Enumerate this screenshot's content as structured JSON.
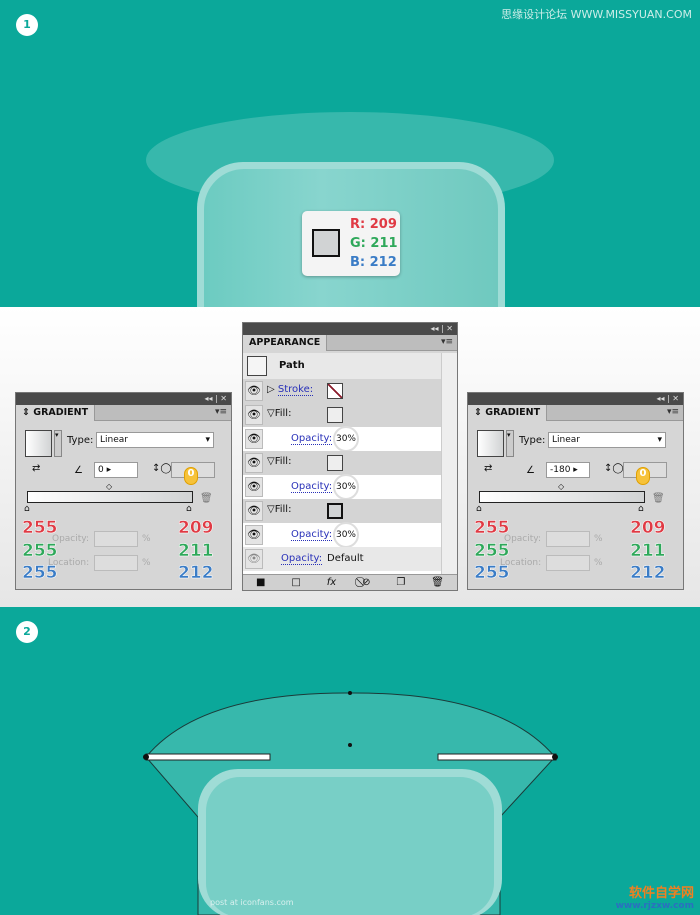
{
  "watermark_top": "思缘设计论坛 WWW.MISSYUAN.COM",
  "step1": {
    "badge": "1",
    "color": {
      "r": "R: 209",
      "g": "G: 211",
      "b": "B: 212",
      "swatch": "#d1d3d4"
    }
  },
  "step2": {
    "badge": "2"
  },
  "appearance": {
    "title": "APPEARANCE",
    "object": "Path",
    "stroke_label": "Stroke:",
    "fill_label": "Fill:",
    "opacity_label": "Opacity:",
    "fills": [
      {
        "opacity": "30%"
      },
      {
        "opacity": "30%"
      },
      {
        "opacity": "30%"
      }
    ],
    "opacity_value": "Default",
    "fx": "fx"
  },
  "gradient_left": {
    "title": "GRADIENT",
    "type_label": "Type:",
    "type": "Linear",
    "angle": "0",
    "aspect_value": "0",
    "opacity_label": "Opacity:",
    "location_label": "Location:",
    "percent": "%",
    "start": {
      "r": "255",
      "g": "255",
      "b": "255"
    },
    "end": {
      "r": "209",
      "g": "211",
      "b": "212"
    }
  },
  "gradient_right": {
    "title": "GRADIENT",
    "type_label": "Type:",
    "type": "Linear",
    "angle": "-180",
    "aspect_value": "0",
    "opacity_label": "Opacity:",
    "location_label": "Location:",
    "percent": "%",
    "start": {
      "r": "255",
      "g": "255",
      "b": "255"
    },
    "end": {
      "r": "209",
      "g": "211",
      "b": "212"
    }
  },
  "footer": {
    "credit": "post at iconfans.com",
    "logo_text": "软件自学网",
    "logo_url": "www.rjzxw.com"
  },
  "colors": {
    "teal": "#0ba89a",
    "red": "#e03a44",
    "green": "#2ea85a",
    "blue": "#3a7cc6"
  }
}
